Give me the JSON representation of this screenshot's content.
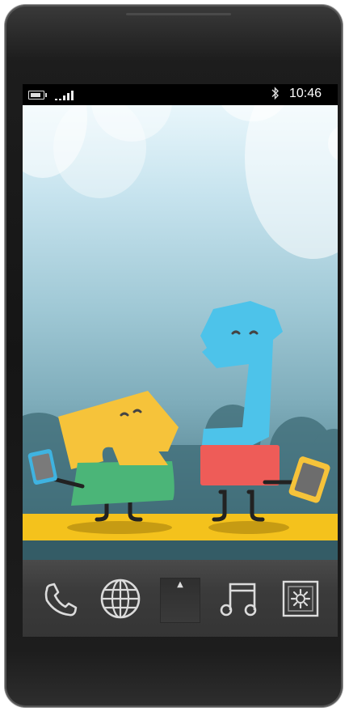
{
  "status_bar": {
    "time": "10:46",
    "icons": [
      "battery-icon",
      "signal-icon",
      "bluetooth-icon"
    ]
  },
  "wallpaper": {
    "description_colors": {
      "sky_top": "#e8f6fb",
      "yellow": "#f6c33a",
      "blue": "#4dc3ea",
      "green": "#4bb578",
      "red": "#ee5c58",
      "floor": "#f4c21c"
    }
  },
  "dock": {
    "items": [
      {
        "name": "phone-icon"
      },
      {
        "name": "globe-icon"
      },
      {
        "name": "app-drawer-up-icon",
        "glyph": "▲"
      },
      {
        "name": "music-icon"
      },
      {
        "name": "settings-icon"
      }
    ]
  }
}
